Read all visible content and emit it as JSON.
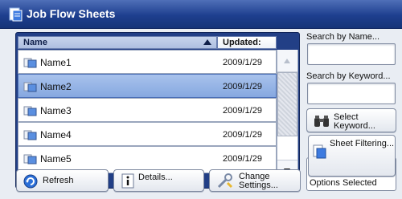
{
  "window": {
    "title": "Job Flow Sheets"
  },
  "list": {
    "columns": {
      "name": "Name",
      "updated": "Updated:"
    },
    "rows": [
      {
        "name": "Name1",
        "date": "2009/1/29",
        "selected": false
      },
      {
        "name": "Name2",
        "date": "2009/1/29",
        "selected": true
      },
      {
        "name": "Name3",
        "date": "2009/1/29",
        "selected": false
      },
      {
        "name": "Name4",
        "date": "2009/1/29",
        "selected": false
      },
      {
        "name": "Name5",
        "date": "2009/1/29",
        "selected": false
      }
    ]
  },
  "buttons": {
    "refresh": "Refresh",
    "details": "Details...",
    "change_line1": "Change",
    "change_line2": "Settings...",
    "select_line1": "Select",
    "select_line2": "Keyword...",
    "filtering": "Sheet Filtering..."
  },
  "side": {
    "search_by_name": "Search by Name...",
    "search_by_keyword": "Search by Keyword...",
    "search_name_value": "",
    "search_keyword_value": "",
    "filter_status": "Options Selected"
  },
  "colors": {
    "title_bar": "#1e3f8f",
    "selection": "#86a8e0",
    "frame": "#223f86"
  }
}
